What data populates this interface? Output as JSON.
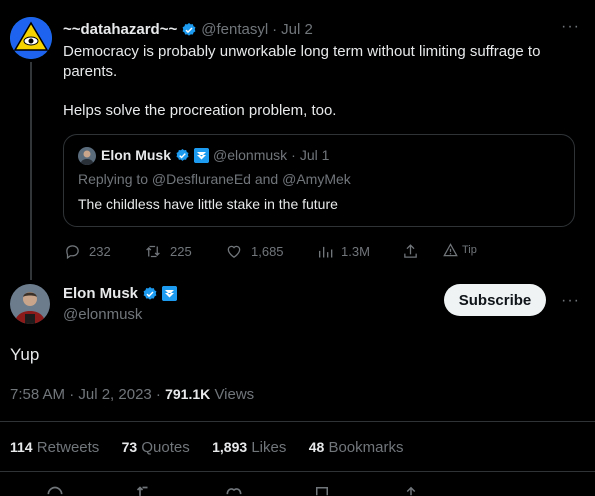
{
  "parent": {
    "display_name": "~~datahazard~~",
    "handle": "@fentasyl",
    "sep": "·",
    "date": "Jul 2",
    "more": "···",
    "text1": "Democracy is probably unworkable long term without limiting suffrage to parents.",
    "text2": "Helps solve the procreation problem, too."
  },
  "quote": {
    "display_name": "Elon Musk",
    "handle": "@elonmusk",
    "sep": "·",
    "date": "Jul 1",
    "replying": "Replying to @DesfluraneEd and @AmyMek",
    "text": "The childless have little stake in the future"
  },
  "actions": {
    "replies": "232",
    "retweets": "225",
    "likes": "1,685",
    "views": "1.3M",
    "tip": "Tip"
  },
  "main": {
    "display_name": "Elon Musk",
    "handle": "@elonmusk",
    "subscribe": "Subscribe",
    "more": "···",
    "text": "Yup",
    "time": "7:58 AM · Jul 2, 2023",
    "views_sep": " · ",
    "views_count": "791.1K",
    "views_label": "Views"
  },
  "stats": {
    "retweets": "114",
    "retweets_label": "Retweets",
    "quotes": "73",
    "quotes_label": "Quotes",
    "likes": "1,893",
    "likes_label": "Likes",
    "bookmarks": "48",
    "bookmarks_label": "Bookmarks"
  },
  "icons": {
    "verified": "verified-badge-icon",
    "reply": "reply-icon",
    "retweet": "retweet-icon",
    "like": "heart-icon",
    "views": "bar-chart-icon",
    "share": "share-icon",
    "tip": "tip-icon"
  },
  "colors": {
    "background": "#000000",
    "accent": "#1d9bf0",
    "muted": "#71767b",
    "text": "#e7e9ea"
  }
}
